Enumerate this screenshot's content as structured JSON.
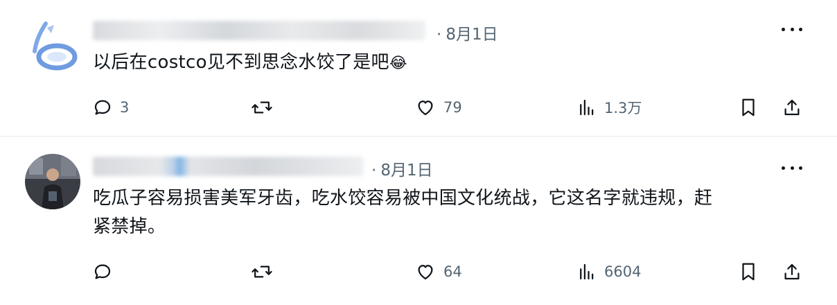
{
  "posts": [
    {
      "date_sep": "·",
      "date": "8月1日",
      "text": "以后在costco见不到思念水饺了是吧",
      "emoji": "😂",
      "counts": {
        "replies": "3",
        "retweets": "",
        "likes": "79",
        "views": "1.3万"
      }
    },
    {
      "date_sep": "·",
      "date": "8月1日",
      "text_line1": "吃瓜子容易损害美军牙齿，吃水饺容易被中国文化统战，它这名字就违规，赶",
      "text_line2": "紧禁掉。",
      "counts": {
        "replies": "",
        "retweets": "",
        "likes": "64",
        "views": "6604"
      }
    }
  ],
  "icons": [
    "reply-icon",
    "retweet-icon",
    "like-icon",
    "views-icon",
    "bookmark-icon",
    "share-icon",
    "more-icon"
  ],
  "colors": {
    "text": "#0f1419",
    "muted": "#536471",
    "divider": "#e6e9ec"
  }
}
